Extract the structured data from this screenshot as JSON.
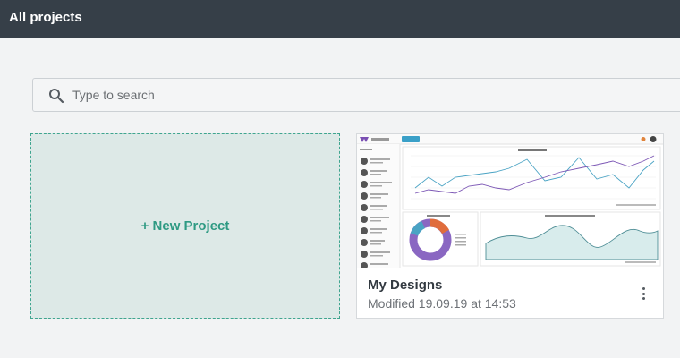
{
  "header": {
    "title": "All projects"
  },
  "search": {
    "placeholder": "Type to search",
    "value": ""
  },
  "new_project": {
    "label": "+ New Project"
  },
  "projects": [
    {
      "title": "My Designs",
      "modified": "Modified 19.09.19 at 14:53"
    }
  ],
  "colors": {
    "topbar": "#363f48",
    "accent": "#2e9a83",
    "card_border": "#d6d9dc"
  },
  "icons": {
    "search": "search-icon",
    "menu": "kebab-menu-icon"
  }
}
